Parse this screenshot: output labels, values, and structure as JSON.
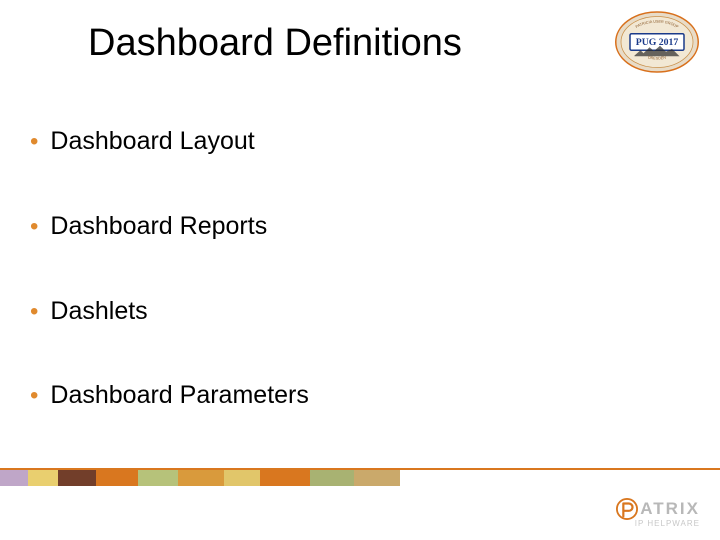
{
  "title": "Dashboard Definitions",
  "badge": {
    "label": "PUG 2017",
    "top_arc": "PATRICIA USER GROUP CONFERENCE",
    "bottom_arc": "DRESDEN • GERMANY"
  },
  "bullets": [
    {
      "text": "Dashboard Layout"
    },
    {
      "text": "Dashboard Reports"
    },
    {
      "text": "Dashlets"
    },
    {
      "text": "Dashboard Parameters"
    }
  ],
  "footer_colors": [
    "#bfa6c8",
    "#e9cf6f",
    "#723e2a",
    "#d9771f",
    "#b6c27a",
    "#d99a3c",
    "#e1c66a",
    "#d9771f",
    "#a8b272",
    "#caa96b"
  ],
  "footer_widths": [
    28,
    30,
    38,
    42,
    40,
    46,
    36,
    50,
    44,
    46
  ],
  "logo": {
    "rest": "ATRIX",
    "sub": "IP HELPWARE"
  }
}
